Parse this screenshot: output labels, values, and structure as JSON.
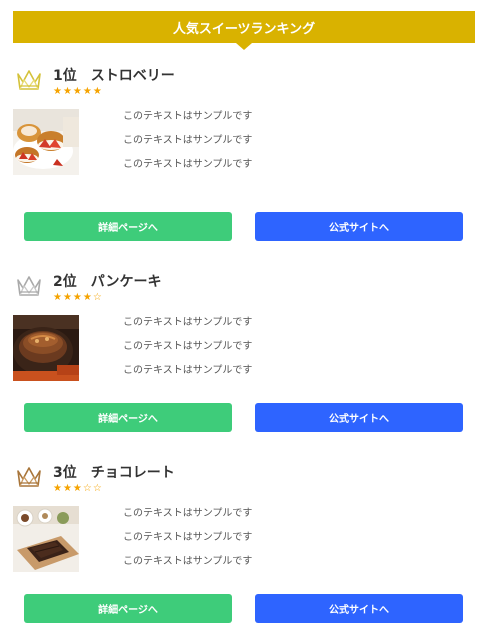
{
  "header": {
    "title": "人気スイーツランキング",
    "color": "#d9b200"
  },
  "items": [
    {
      "rank_label": "1位",
      "name": "ストロベリー",
      "rating": 5,
      "rating_max": 5,
      "stars_text": "★★★★★",
      "crown_color": "#d4c23a",
      "lines": [
        "このテキストはサンプルです",
        "このテキストはサンプルです",
        "このテキストはサンプルです"
      ],
      "detail_label": "詳細ページへ",
      "official_label": "公式サイトへ"
    },
    {
      "rank_label": "2位",
      "name": "パンケーキ",
      "rating": 4,
      "rating_max": 5,
      "stars_text": "★★★★☆",
      "crown_color": "#a9a9a9",
      "lines": [
        "このテキストはサンプルです",
        "このテキストはサンプルです",
        "このテキストはサンプルです"
      ],
      "detail_label": "詳細ページへ",
      "official_label": "公式サイトへ"
    },
    {
      "rank_label": "3位",
      "name": "チョコレート",
      "rating": 3,
      "rating_max": 5,
      "stars_text": "★★★☆☆",
      "crown_color": "#a8753a",
      "lines": [
        "このテキストはサンプルです",
        "このテキストはサンプルです",
        "このテキストはサンプルです"
      ],
      "detail_label": "詳細ページへ",
      "official_label": "公式サイトへ"
    }
  ],
  "colors": {
    "detail_button": "#3ecc7a",
    "official_button": "#2e64ff",
    "star": "#f5a300"
  }
}
